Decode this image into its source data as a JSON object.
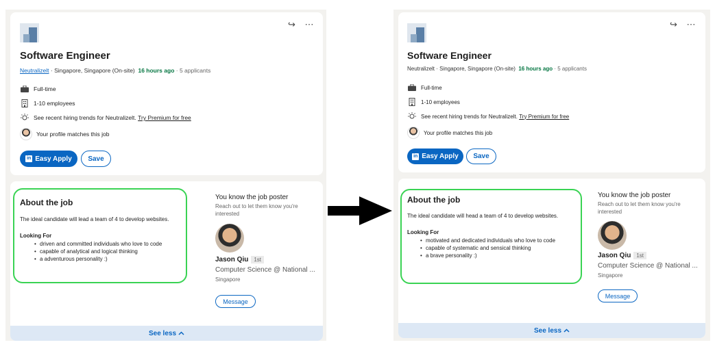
{
  "left": {
    "job_title": "Software Engineer",
    "company": "Neutralizelt",
    "location": "· Singapore, Singapore (On-site)",
    "posted": "16 hours ago",
    "applicants": "· 5 applicants",
    "job_type": "Full-time",
    "company_size": "1-10 employees",
    "trends_text": "See recent hiring trends for Neutralizelt.",
    "trends_link": "Try Premium for free",
    "profile_match": "Your profile matches this job",
    "easy_apply_label": "Easy Apply",
    "save_label": "Save",
    "about_title": "About the job",
    "about_intro": "The ideal candidate will lead a team of 4 to develop websites.",
    "looking_for": "Looking For",
    "bullets": [
      "driven and committed individuals who love to code",
      "capable of analytical and logical thinking",
      "a adventurous personality :)"
    ],
    "poster_heading": "You know the job poster",
    "poster_sub": "Reach out to let them know you're interested",
    "poster_name": "Jason Qiu",
    "poster_degree": "1st",
    "poster_role": "Computer Science @ National ...",
    "poster_location": "Singapore",
    "message_label": "Message",
    "see_less_label": "See less"
  },
  "right": {
    "job_title": "Software Engineer",
    "company": "Neutralizelt",
    "location": "· Singapore, Singapore (On-site)",
    "posted": "16 hours ago",
    "applicants": "· 5 applicants",
    "job_type": "Full-time",
    "company_size": "1-10 employees",
    "trends_text": "See recent hiring trends for Neutralizelt.",
    "trends_link": "Try Premium for free",
    "profile_match": "Your profile matches this job",
    "easy_apply_label": "Easy Apply",
    "save_label": "Save",
    "about_title": "About the job",
    "about_intro": "The ideal candidate will head a team of 4 to develop websites.",
    "looking_for": "Looking For",
    "bullets": [
      "motivated and dedicated individuals who love to code",
      "capable of systematic and sensical thinking",
      "a brave personality :)"
    ],
    "poster_heading": "You know the job poster",
    "poster_sub": "Reach out to let them know you're interested",
    "poster_name": "Jason Qiu",
    "poster_degree": "1st",
    "poster_role": "Computer Science @ National ...",
    "poster_location": "Singapore",
    "message_label": "Message",
    "see_less_label": "See less"
  },
  "icons": {
    "share": "share-arrow-icon",
    "more": "ellipsis-icon",
    "arrow": "right-arrow-icon"
  },
  "colors": {
    "brand_blue": "#0a66c2",
    "highlight_green": "#39d353",
    "posted_green": "#057642",
    "see_less_bg": "#dde8f5"
  }
}
